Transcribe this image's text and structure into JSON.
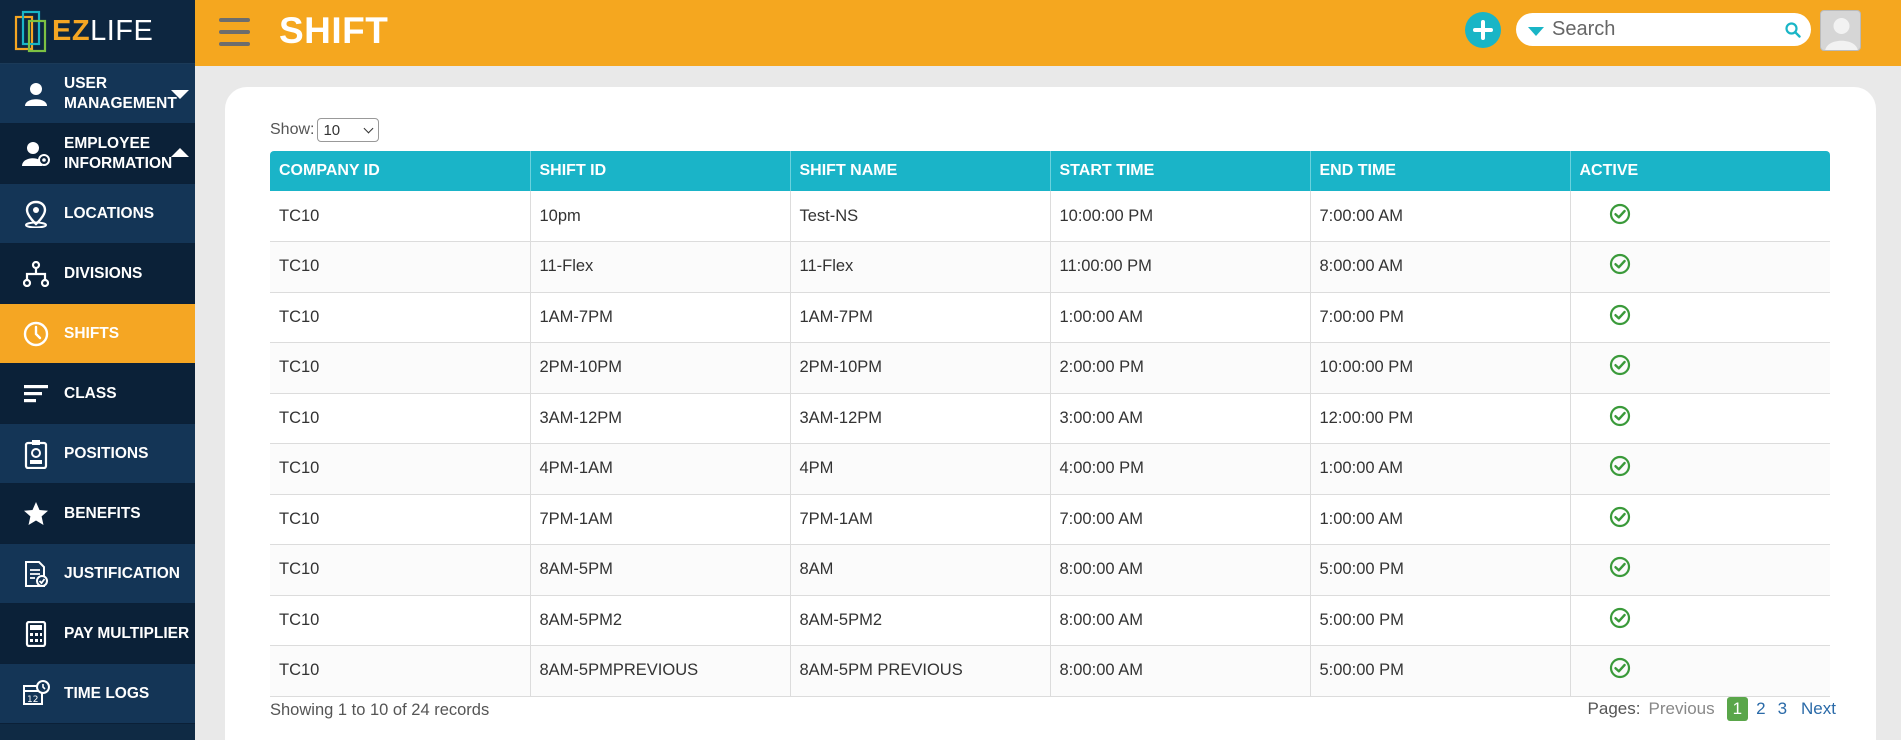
{
  "app": {
    "logo_ez": "EZ",
    "logo_life": "LIFE"
  },
  "header": {
    "title": "SHIFT",
    "search_placeholder": "Search"
  },
  "sidebar": {
    "items": [
      {
        "label": "USER MANAGEMENT",
        "icon": "user-icon"
      },
      {
        "label": "EMPLOYEE INFORMATION",
        "icon": "user-gear-icon"
      },
      {
        "label": "LOCATIONS",
        "icon": "location-pin-icon"
      },
      {
        "label": "DIVISIONS",
        "icon": "hierarchy-icon"
      },
      {
        "label": "SHIFTS",
        "icon": "clock-icon"
      },
      {
        "label": "CLASS",
        "icon": "lines-icon"
      },
      {
        "label": "POSITIONS",
        "icon": "id-badge-icon"
      },
      {
        "label": "BENEFITS",
        "icon": "star-icon"
      },
      {
        "label": "JUSTIFICATION",
        "icon": "document-check-icon"
      },
      {
        "label": "PAY MULTIPLIER",
        "icon": "calculator-icon"
      },
      {
        "label": "TIME LOGS",
        "icon": "calendar-clock-icon"
      }
    ]
  },
  "table": {
    "show_label": "Show:",
    "show_value": "10",
    "columns": [
      "COMPANY ID",
      "SHIFT ID",
      "SHIFT NAME",
      "START TIME",
      "END TIME",
      "ACTIVE"
    ],
    "rows": [
      [
        "TC10",
        "10pm",
        "Test-NS",
        "10:00:00 PM",
        "7:00:00 AM"
      ],
      [
        "TC10",
        "11-Flex",
        "11-Flex",
        "11:00:00 PM",
        "8:00:00 AM"
      ],
      [
        "TC10",
        "1AM-7PM",
        "1AM-7PM",
        "1:00:00 AM",
        "7:00:00 PM"
      ],
      [
        "TC10",
        "2PM-10PM",
        "2PM-10PM",
        "2:00:00 PM",
        "10:00:00 PM"
      ],
      [
        "TC10",
        "3AM-12PM",
        "3AM-12PM",
        "3:00:00 AM",
        "12:00:00 PM"
      ],
      [
        "TC10",
        "4PM-1AM",
        "4PM",
        "4:00:00 PM",
        "1:00:00 AM"
      ],
      [
        "TC10",
        "7PM-1AM",
        "7PM-1AM",
        "7:00:00 AM",
        "1:00:00 AM"
      ],
      [
        "TC10",
        "8AM-5PM",
        "8AM",
        "8:00:00 AM",
        "5:00:00 PM"
      ],
      [
        "TC10",
        "8AM-5PM2",
        "8AM-5PM2",
        "8:00:00 AM",
        "5:00:00 PM"
      ],
      [
        "TC10",
        "8AM-5PMPREVIOUS",
        "8AM-5PM PREVIOUS",
        "8:00:00 AM",
        "5:00:00 PM"
      ]
    ],
    "active_icon": "check-circle-icon",
    "records_text": "Showing 1 to 10 of 24 records"
  },
  "pagination": {
    "label": "Pages:",
    "previous": "Previous",
    "pages": [
      "1",
      "2",
      "3"
    ],
    "current": "1",
    "next": "Next"
  },
  "colors": {
    "accent": "#f5a71f",
    "sidebar": "#0f2a44",
    "table_header": "#1ab4c8",
    "check": "#3a9a3a",
    "current_page": "#5aa64a"
  }
}
